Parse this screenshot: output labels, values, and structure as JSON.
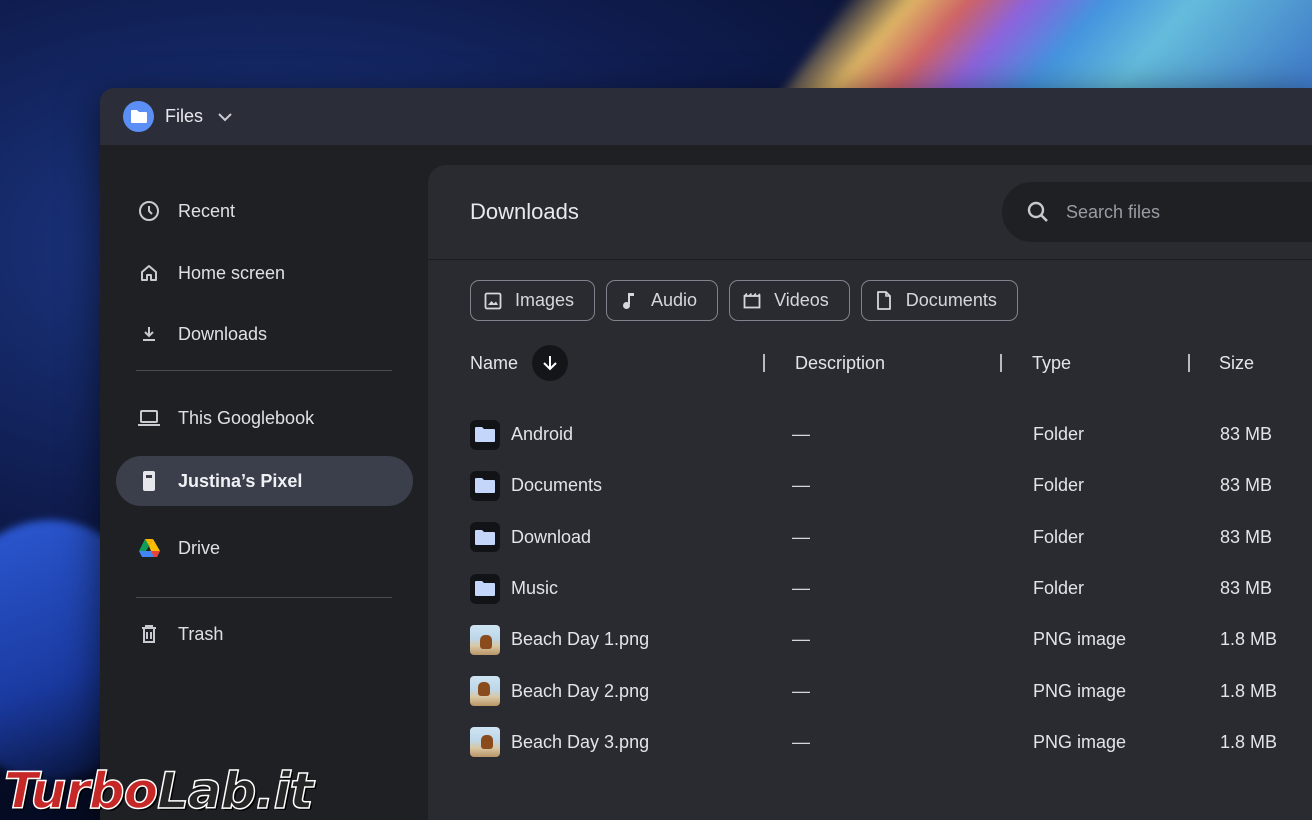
{
  "app": {
    "title": "Files"
  },
  "sidebar": {
    "items": [
      {
        "label": "Recent",
        "icon": "clock-icon"
      },
      {
        "label": "Home screen",
        "icon": "home-icon"
      },
      {
        "label": "Downloads",
        "icon": "download-icon"
      },
      {
        "label": "This Googlebook",
        "icon": "laptop-icon"
      },
      {
        "label": "Justina’s Pixel",
        "icon": "phone-icon",
        "active": true
      },
      {
        "label": "Drive",
        "icon": "google-drive-icon"
      },
      {
        "label": "Trash",
        "icon": "trash-icon"
      }
    ]
  },
  "main": {
    "title": "Downloads",
    "search": {
      "placeholder": "Search files"
    },
    "chips": [
      {
        "label": "Images",
        "icon": "image-icon"
      },
      {
        "label": "Audio",
        "icon": "music-note-icon"
      },
      {
        "label": "Videos",
        "icon": "video-icon"
      },
      {
        "label": "Documents",
        "icon": "document-icon"
      }
    ],
    "columns": {
      "name": "Name",
      "description": "Description",
      "type": "Type",
      "size": "Size"
    },
    "files": [
      {
        "name": "Android",
        "description": "—",
        "type": "Folder",
        "size": "83 MB",
        "kind": "folder"
      },
      {
        "name": "Documents",
        "description": "—",
        "type": "Folder",
        "size": "83 MB",
        "kind": "folder"
      },
      {
        "name": "Download",
        "description": "—",
        "type": "Folder",
        "size": "83 MB",
        "kind": "folder"
      },
      {
        "name": "Music",
        "description": "—",
        "type": "Folder",
        "size": "83 MB",
        "kind": "folder"
      },
      {
        "name": "Beach Day 1.png",
        "description": "—",
        "type": "PNG image",
        "size": "1.8 MB",
        "kind": "image"
      },
      {
        "name": "Beach Day 2.png",
        "description": "—",
        "type": "PNG image",
        "size": "1.8 MB",
        "kind": "image"
      },
      {
        "name": "Beach Day 3.png",
        "description": "—",
        "type": "PNG image",
        "size": "1.8 MB",
        "kind": "image"
      }
    ]
  },
  "watermark": {
    "part1": "Turbo",
    "part2": "Lab.it"
  },
  "colors": {
    "accent": "#5b8ff5",
    "window": "#1f2024",
    "content": "#2a2b30",
    "active_nav": "#3b3f4b"
  }
}
